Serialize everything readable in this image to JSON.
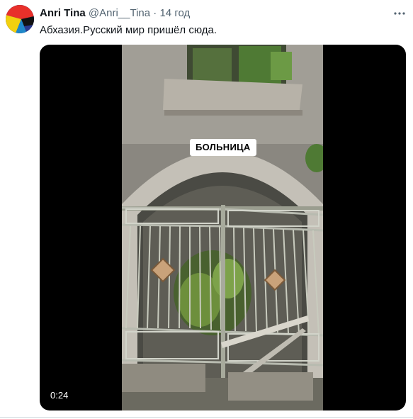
{
  "tweet": {
    "author_name": "Anri Tina",
    "handle": "@Anri__Tina",
    "separator": "·",
    "time": "14 год",
    "text": "Абхазия.Русский мир пришёл сюда.",
    "avatar_colors": [
      "#e8302a",
      "#f2d00f",
      "#1d2a7a",
      "#1f88c9",
      "#111111"
    ]
  },
  "media": {
    "type": "video",
    "duration": "0:24",
    "overlay_caption": "БОЛЬНИЦА"
  },
  "icons": {
    "more": "more-options-icon",
    "play": "video-thumbnail"
  }
}
